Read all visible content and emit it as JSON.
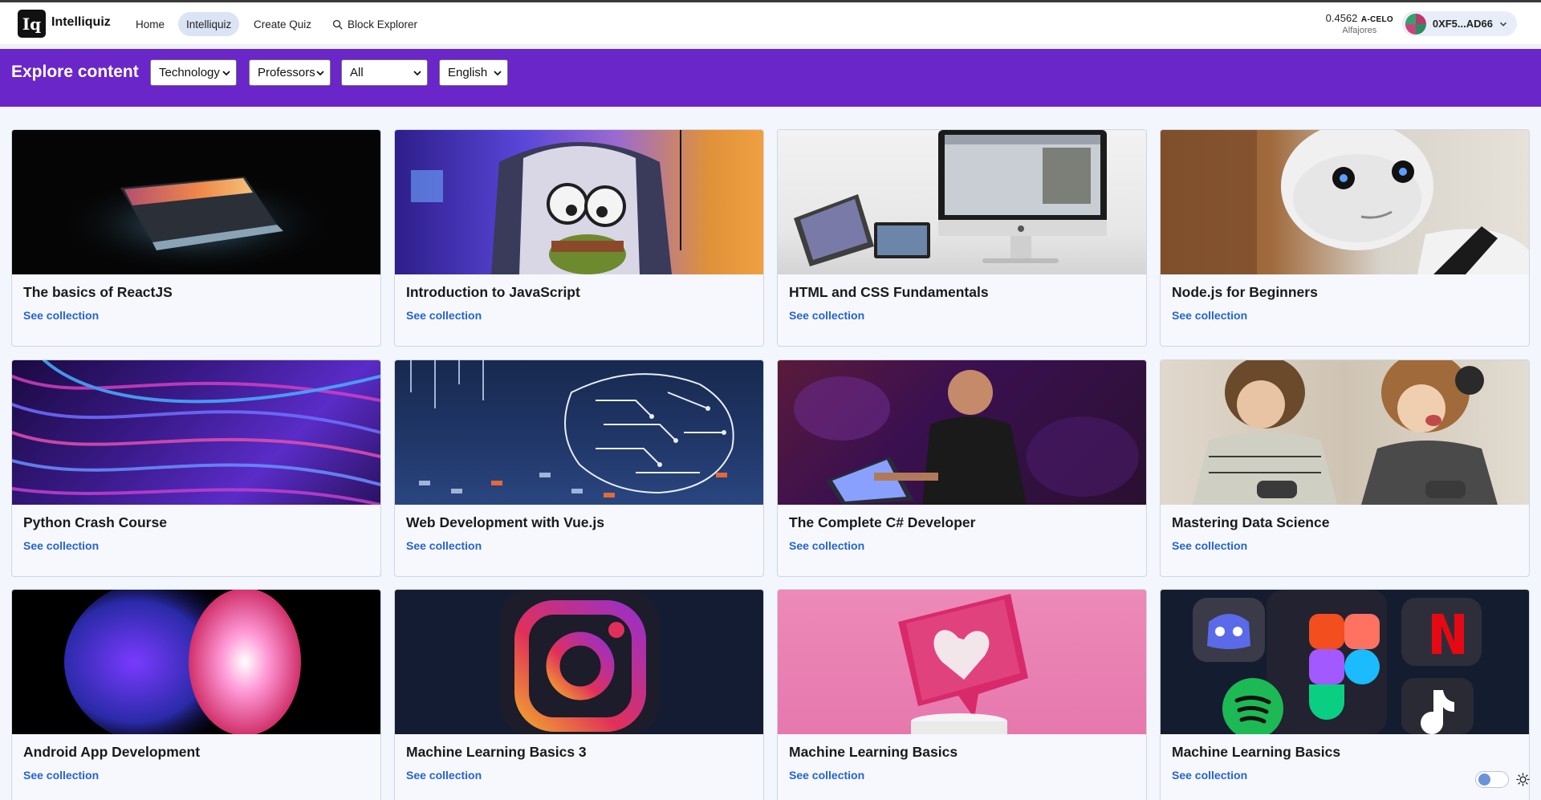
{
  "nav": {
    "brand": "Intelliquiz",
    "logo_mark": "Iq",
    "links": [
      {
        "label": "Home"
      },
      {
        "label": "Intelliquiz"
      },
      {
        "label": "Create Quiz"
      },
      {
        "label": "Block Explorer"
      }
    ],
    "balance_amount": "0.4562",
    "balance_currency": "A-CELO",
    "network": "Alfajores",
    "wallet_address": "0XF5...AD66"
  },
  "explore": {
    "title": "Explore content",
    "filters": [
      {
        "selected": "Technology"
      },
      {
        "selected": "Professors"
      },
      {
        "selected": "All"
      },
      {
        "selected": "English"
      }
    ]
  },
  "collections": [
    {
      "title": "The basics of ReactJS",
      "link": "See collection"
    },
    {
      "title": "Introduction to JavaScript",
      "link": "See collection"
    },
    {
      "title": "HTML and CSS Fundamentals",
      "link": "See collection"
    },
    {
      "title": "Node.js for Beginners",
      "link": "See collection"
    },
    {
      "title": "Python Crash Course",
      "link": "See collection"
    },
    {
      "title": "Web Development with Vue.js",
      "link": "See collection"
    },
    {
      "title": "The Complete C# Developer",
      "link": "See collection"
    },
    {
      "title": "Mastering Data Science",
      "link": "See collection"
    },
    {
      "title": "Android App Development",
      "link": "See collection"
    },
    {
      "title": "Machine Learning Basics 3",
      "link": "See collection"
    },
    {
      "title": "Machine Learning Basics",
      "link": "See collection"
    },
    {
      "title": "Machine Learning Basics",
      "link": "See collection"
    }
  ],
  "colors": {
    "accent": "#6a26c8",
    "link": "#2563d0",
    "page_bg": "#f3f6fc"
  },
  "icons": {
    "search": "search-icon",
    "chevron": "chevron-down-icon",
    "theme": "sun-icon"
  }
}
